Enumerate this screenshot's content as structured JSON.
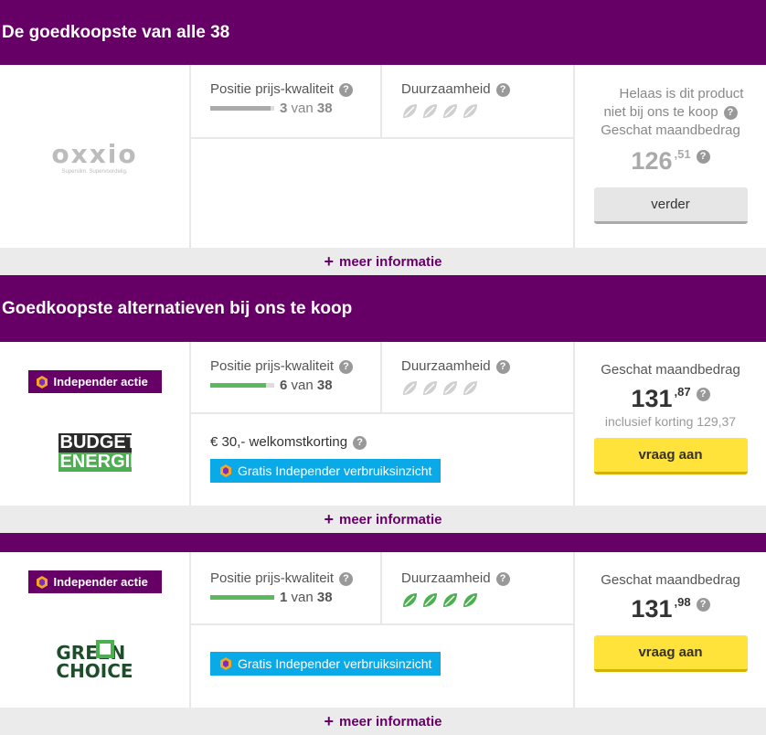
{
  "section1": {
    "title": "De goedkoopste van alle 38"
  },
  "section2": {
    "title": "Goedkoopste alternatieven bij ons te koop"
  },
  "labels": {
    "position": "Positie prijs-kwaliteit",
    "durability": "Duurzaamheid",
    "estimated": "Geschat maandbedrag",
    "more_info": "meer informatie",
    "help": "?",
    "van": "van"
  },
  "card1": {
    "logo": "oxxio",
    "logo_tagline": "Superslim. Supervoordelig.",
    "rank": "3",
    "total": "38",
    "rank_fraction": 0.947,
    "leaves_active": 0,
    "unavailable_1": "Helaas is dit product",
    "unavailable_2": "niet bij ons te koop",
    "price_main": "126",
    "price_cents": ",51",
    "button": "verder"
  },
  "card2": {
    "badge": "Independer actie",
    "logo_line1": "BUDGET",
    "logo_line2": "ENERGIE",
    "rank": "6",
    "total": "38",
    "rank_fraction": 0.868,
    "leaves_active": 0,
    "welcome": "€ 30,- welkomstkorting",
    "tag": "Gratis Independer verbruiksinzicht",
    "price_main": "131",
    "price_cents": ",87",
    "discount_note": "inclusief korting 129,37",
    "button": "vraag aan"
  },
  "card3": {
    "badge": "Independer actie",
    "logo_line1": "GREEN",
    "logo_line2": "CHOICE",
    "rank": "1",
    "total": "38",
    "rank_fraction": 1.0,
    "leaves_active": 4,
    "tag": "Gratis Independer verbruiksinzicht",
    "price_main": "131",
    "price_cents": ",98",
    "button": "vraag aan"
  },
  "colors": {
    "brand": "#660066",
    "bar_gray": "#aaaaaa",
    "bar_green": "#5cb85c",
    "leaf_green": "#4caf50",
    "leaf_gray": "#d0d0d0",
    "tag_blue": "#0aa9e8",
    "button_yellow": "#ffe23a"
  }
}
